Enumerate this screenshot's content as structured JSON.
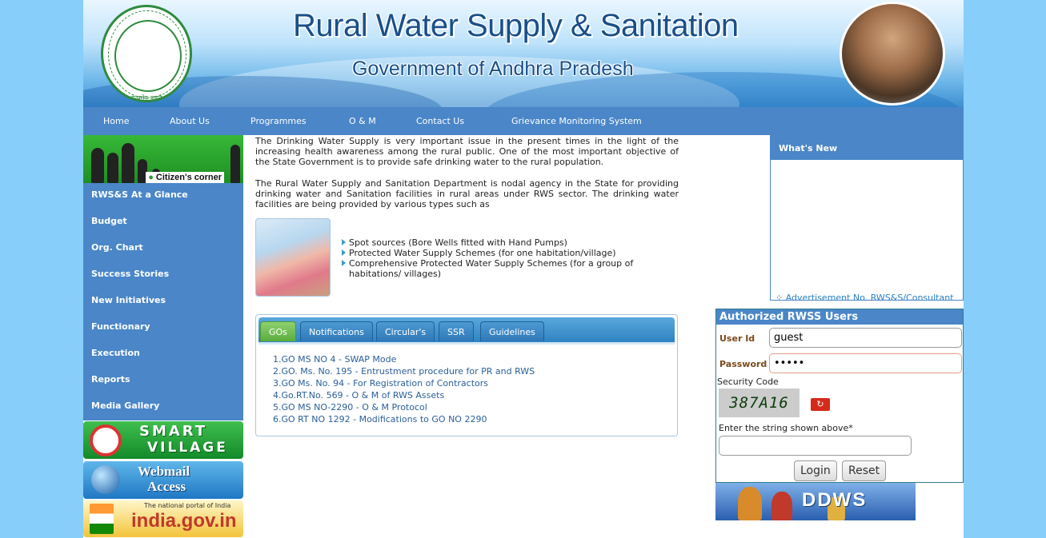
{
  "header": {
    "title": "Rural Water Supply & Sanitation",
    "subtitle": "Government of Andhra Pradesh",
    "seal_caption": "सत्यमेव जयते"
  },
  "nav": {
    "items": [
      "Home",
      "About Us",
      "Programmes",
      "O & M",
      "Contact Us",
      "Grievance Monitoring System"
    ]
  },
  "sidebar": {
    "citizens_corner": "Citizen's corner",
    "items": [
      "RWS&S At a Glance",
      "Budget",
      "Org. Chart",
      "Success Stories",
      "New Initiatives",
      "Functionary",
      "Execution",
      "Reports",
      "Media Gallery"
    ],
    "banners": {
      "smart_line1": "SMART",
      "smart_line2": "VILLAGE",
      "webmail_line1": "Webmail",
      "webmail_line2": "Access",
      "india_tag": "The national portal of India",
      "india_text": "india.gov.in"
    }
  },
  "content": {
    "para1": "The Drinking Water Supply is very important issue in the present times in the light of the increasing health awareness among the rural public. One of the most important objective of the State Government is to provide safe drinking water to the rural population.",
    "para2": "The Rural Water Supply and Sanitation Department is nodal agency in the State for providing drinking water and Sanitation facilities in rural areas under RWS sector. The drinking water facilities are being provided by various types such as",
    "schemes": [
      "Spot sources (Bore Wells fitted with Hand Pumps)",
      "Protected Water Supply Schemes (for one habitation/village)",
      "Comprehensive Protected Water Supply Schemes (for a group of habitations/ villages)"
    ]
  },
  "tabs": {
    "labels": [
      "GOs",
      "Notifications",
      "Circular's",
      "SSR",
      "Guidelines"
    ],
    "active": "GOs",
    "go_items": [
      "1.GO MS NO 4 - SWAP Mode",
      "2.GO. Ms. No. 195 - Entrustment procedure for PR and RWS",
      "3.GO Ms. No. 94 - For Registration of Contractors",
      "4.Go.RT.No. 569 - O & M of RWS Assets",
      "5.GO MS NO-2290 - O & M Protocol",
      "6.GO RT NO 1292 - Modifications to GO NO 2290"
    ]
  },
  "whats_new": {
    "title": "What's New",
    "ticker_item": "Advertisement No. RWS&S/Consultant"
  },
  "login": {
    "title": "Authorized RWSS Users",
    "user_id_label": "User Id",
    "user_id_value": "guest",
    "password_label": "Password",
    "password_value": "guest",
    "security_code_label": "Security Code",
    "captcha_text": "387A16",
    "captcha_prompt": "Enter the string shown above*",
    "captcha_value": "",
    "login_label": "Login",
    "reset_label": "Reset"
  },
  "ddws_banner": "DDWS",
  "colors": {
    "page_bg": "#87cefa",
    "nav_bg": "#4a86c8",
    "active_tab": "#6cbc4a",
    "link": "#2a5f99"
  }
}
